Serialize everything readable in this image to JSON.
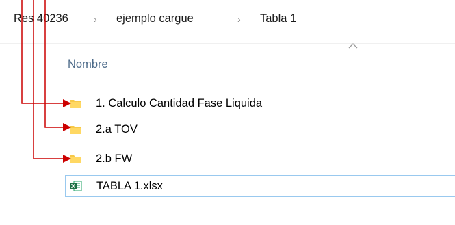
{
  "breadcrumb": {
    "items": [
      "Res 40236",
      "ejemplo cargue",
      "Tabla 1"
    ],
    "separator": "›"
  },
  "list": {
    "column_header": "Nombre",
    "items": [
      {
        "name": "1. Calculo Cantidad Fase Liquida",
        "icon": "folder-icon"
      },
      {
        "name": "2.a TOV",
        "icon": "folder-icon"
      },
      {
        "name": "2.b FW",
        "icon": "folder-icon"
      },
      {
        "name": "TABLA 1.xlsx",
        "icon": "excel-file-icon"
      }
    ]
  },
  "colors": {
    "annotation": "#cc0000",
    "folder": "#f7c948",
    "excel": "#1e7145",
    "selection_border": "#99c9ef",
    "header_text": "#4d6b8a"
  }
}
